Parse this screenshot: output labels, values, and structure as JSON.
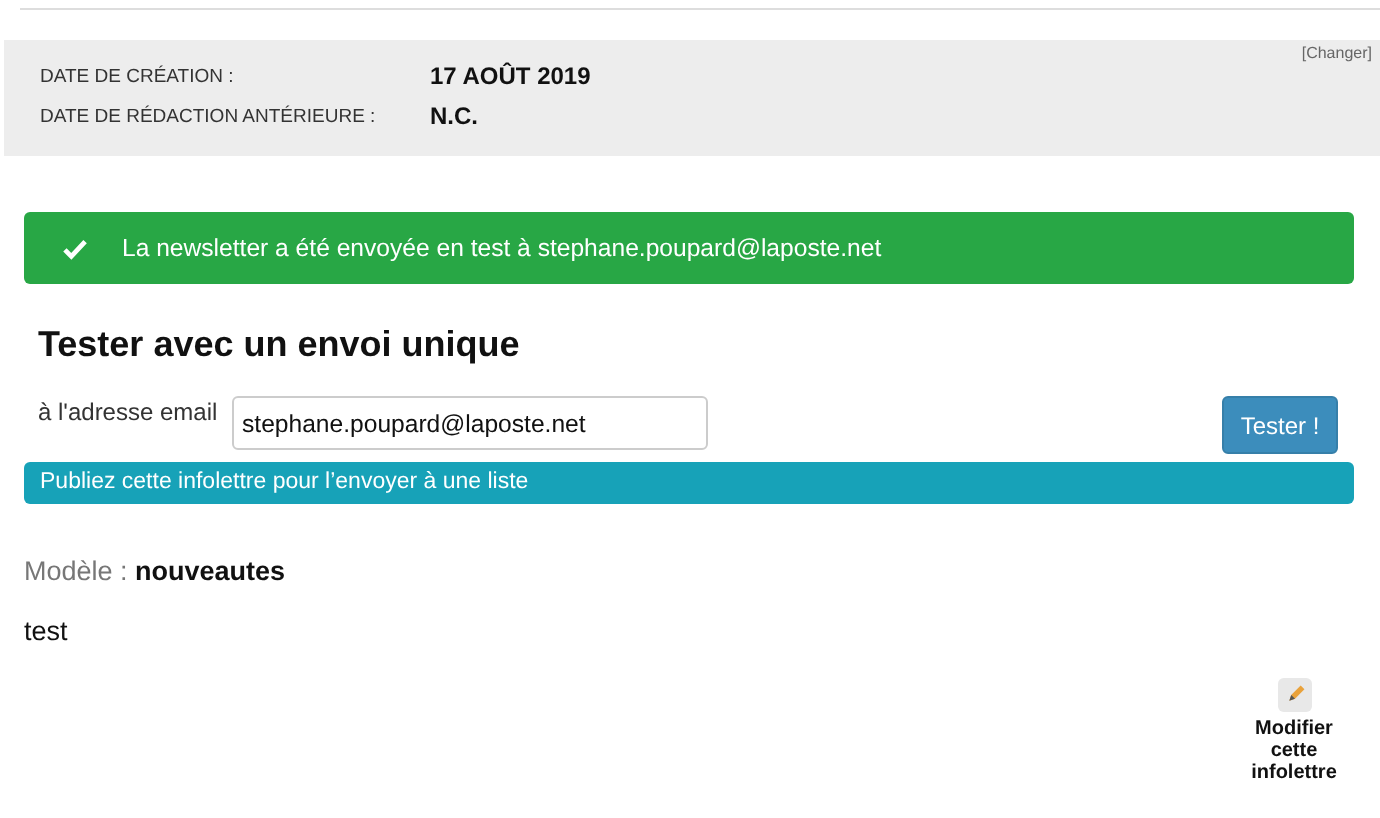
{
  "info_panel": {
    "change_link": "[Changer]",
    "rows": [
      {
        "label": "DATE DE CRÉATION :",
        "value": "17 AOÛT 2019"
      },
      {
        "label": "DATE DE RÉDACTION ANTÉRIEURE :",
        "value": "N.C."
      }
    ]
  },
  "alert": {
    "kind": "success",
    "text": "La newsletter a été envoyée en test à stephane.poupard@laposte.net"
  },
  "test_form": {
    "title": "Tester avec un envoi unique",
    "label": "à l'adresse email",
    "value": "stephane.poupard@laposte.net",
    "button": "Tester !"
  },
  "notice": "Publiez cette infolettre pour l’envoyer à une liste",
  "template": {
    "label": "Modèle :",
    "value": "nouveautes"
  },
  "body_text": "test",
  "edit_action": "Modifier cette infolettre"
}
